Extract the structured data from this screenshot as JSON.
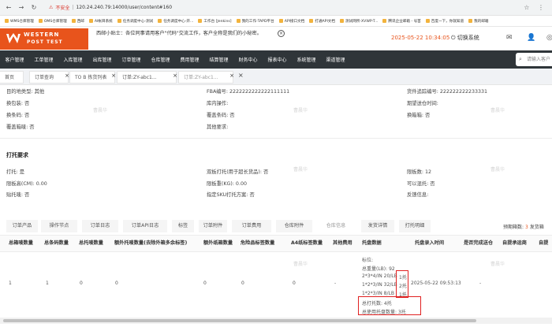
{
  "browser": {
    "insecure_label": "不安全",
    "url": "120.24.240.79:14000/user/content#160",
    "bookmarks": [
      "WMS仓库管理",
      "OMS仓库管理",
      "西邮",
      "AI帐目系统",
      "任务调度中心-测试",
      "任务调度中心-开...",
      "工作台 [Jenkins]",
      "我的工作-TAPD平台",
      "API接口文档",
      "打通API文档",
      "测试网所-XVWP-T...",
      "腾讯企业邮箱 - 号首",
      "百度一下，你就知道",
      "我的邮箱"
    ]
  },
  "header": {
    "logo_line1": "WESTERN",
    "logo_line2": "POST TEST",
    "notice": "西邮小贴士：各位同事请用客户\"代码\"交流工作，客户全称是我们的小秘密。",
    "time": "2025-05-22 10:34:05",
    "switch_label": "切换系统"
  },
  "nav": {
    "items": [
      "客户管理",
      "工单管理",
      "入库管理",
      "出库管理",
      "订单管理",
      "仓库管理",
      "费用管理",
      "结算管理",
      "财务中心",
      "报表中心",
      "系统管理",
      "渠道管理"
    ],
    "search_placeholder": "请输入客户"
  },
  "tabs": [
    {
      "label": "首页"
    },
    {
      "label": "订单查询"
    },
    {
      "label": "TO B 拣货列表"
    },
    {
      "label": "订单:ZY-abc1..."
    },
    {
      "label": "订单:ZY-abc1..."
    }
  ],
  "watermark": "曹晨华",
  "info": {
    "row1": [
      "目的地类型: 其他",
      "FBA编号: 2222222222222111111",
      "货件追踪编号: 222222222233331"
    ],
    "row2": [
      "换包装: 否",
      "库内操作:",
      "期望送仓时间:"
    ],
    "row3": [
      "换条码: 否",
      "覆盖条码: 否",
      "换箱箱: 否"
    ],
    "row4": [
      "覆盖箱唛: 否",
      "其他要求:"
    ]
  },
  "pallet": {
    "title": "打托要求",
    "row1": [
      "打托: 是",
      "双板打托(用于超长货品): 否",
      "限板数: 12"
    ],
    "row2": [
      "限板高(CM): 0.00",
      "限板重(KG): 0.00",
      "可以混托: 否"
    ],
    "row3": [
      "贴托唛: 否",
      "指定SKU打托方案: 否",
      "反馈信息:"
    ]
  },
  "subtabs": [
    "订单产品",
    "操作节点",
    "订单日志",
    "订单API日志",
    "标签",
    "订单附件",
    "订单费用",
    "仓库附件",
    "仓库信息",
    "发货详情",
    "打托明细"
  ],
  "stats": {
    "prefix": "预期箱数:",
    "expected": "3",
    "shipped_label": "发货箱"
  },
  "table": {
    "headers": [
      "总箱唛数量",
      "总条码数量",
      "总托唛数量",
      "额外托唛数量(去除外箱多余标签)",
      "额外纸箱数量",
      "危险品标签数量",
      "A4纸标签数量",
      "其他费用",
      "托盘数据",
      "托盘录入时间",
      "是否完成送仓",
      "自提承运商",
      "自提"
    ],
    "row": [
      "1",
      "1",
      "0",
      "0",
      "0",
      "0",
      "0",
      "-"
    ],
    "pallet_lines": [
      "标位:",
      "总重量(LB): 92",
      "2*3*4/IN 20/LB",
      "1*2*3/IN 32/LB",
      "1*2*3/IN 8/LB"
    ],
    "pallet_counts": [
      "1托",
      "2托",
      "1托"
    ],
    "pallet_total": "总打托数: 4托",
    "pallet_used": "总使用托盘数量: 3托",
    "entry_time": "2025-05-22 09:53:13",
    "done": "-"
  }
}
